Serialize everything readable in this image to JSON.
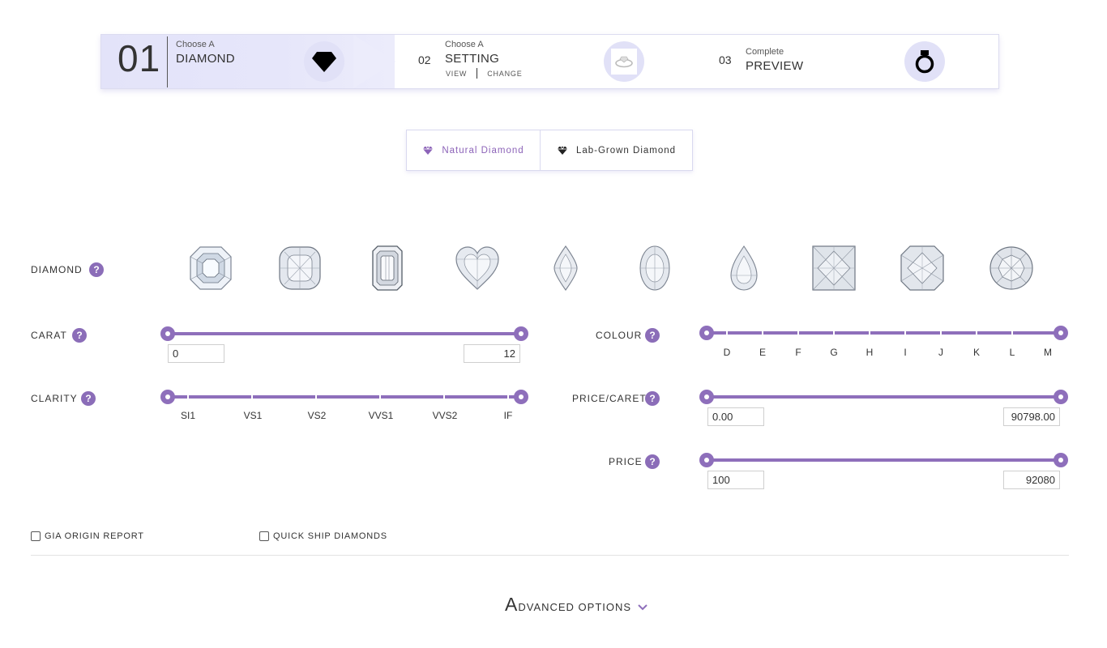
{
  "stepper": {
    "step1": {
      "number": "01",
      "small": "Choose A",
      "label": "DIAMOND",
      "icon": "diamond-icon"
    },
    "step2": {
      "number": "02",
      "small": "Choose A",
      "label": "SETTING",
      "view": "VIEW",
      "change": "CHANGE",
      "icon": "ring-setting-icon"
    },
    "step3": {
      "number": "03",
      "small": "Complete",
      "label": "PREVIEW",
      "icon": "ring-icon"
    }
  },
  "diamond_type": {
    "natural": "Natural Diamond",
    "lab": "Lab-Grown Diamond",
    "selected": "Natural Diamond"
  },
  "filters": {
    "diamond_label": "DIAMOND",
    "shapes": [
      "asscher",
      "cushion",
      "emerald",
      "heart",
      "marquise",
      "oval",
      "pear",
      "princess",
      "radiant",
      "round"
    ],
    "carat": {
      "label": "CARAT",
      "min": "0",
      "max": "12"
    },
    "colour": {
      "label": "COLOUR",
      "grades": [
        "D",
        "E",
        "F",
        "G",
        "H",
        "I",
        "J",
        "K",
        "L",
        "M"
      ]
    },
    "clarity": {
      "label": "CLARITY",
      "grades": [
        "SI1",
        "VS1",
        "VS2",
        "VVS1",
        "VVS2",
        "IF"
      ]
    },
    "price_carat": {
      "label": "PRICE/CARET",
      "min": "0.00",
      "max": "90798.00"
    },
    "price": {
      "label": "PRICE",
      "min": "100",
      "max": "92080"
    },
    "help_glyph": "?"
  },
  "checkboxes": {
    "gia": "GIA ORIGIN REPORT",
    "quick_ship": "QUICK SHIP DIAMONDS"
  },
  "advanced": {
    "first_letter": "A",
    "rest": "DVANCED OPTIONS"
  },
  "colors": {
    "accent": "#8e6fbb",
    "step_bg": "#e6e6fa"
  }
}
